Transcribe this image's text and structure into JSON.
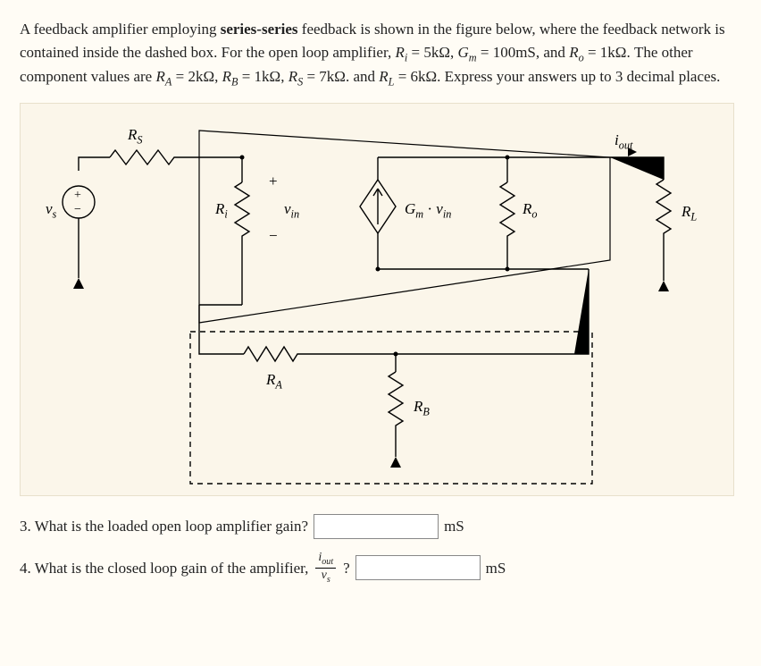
{
  "problem": {
    "intro_1": "A feedback amplifier employing ",
    "feedback_type": "series-series",
    "intro_2": " feedback is shown in the figure below, where the feedback network is contained inside the dashed box. For the open loop amplifier, ",
    "Ri_sym": "R",
    "Ri_sub": "i",
    "eq": " = ",
    "Ri_val": "5kΩ",
    "comma": ", ",
    "Gm_sym": "G",
    "Gm_sub": "m",
    "Gm_val": "100mS",
    "and1": ", and ",
    "Ro_sym": "R",
    "Ro_sub": "o",
    "Ro_val": "1kΩ",
    "period": ". ",
    "other_intro": "The other component values are ",
    "RA_sym": "R",
    "RA_sub": "A",
    "RA_val": "2kΩ",
    "RB_sym": "R",
    "RB_sub": "B",
    "RB_val": "1kΩ",
    "RS_sym": "R",
    "RS_sub": "S",
    "RS_val": "7kΩ",
    "and2": ". and ",
    "RL_sym": "R",
    "RL_sub": "L",
    "RL_val": "6kΩ",
    "closing": ". Express your answers up to 3 decimal places."
  },
  "circuit": {
    "RS": "R",
    "RS_sub": "S",
    "vs": "v",
    "vs_sub": "s",
    "Ri": "R",
    "Ri_sub": "i",
    "vin": "v",
    "vin_sub": "in",
    "plus": "+",
    "minus": "−",
    "Gm": "G",
    "Gm_sub": "m",
    "dot": " · ",
    "Ro": "R",
    "Ro_sub": "o",
    "iout": "i",
    "iout_sub": "out",
    "RL": "R",
    "RL_sub": "L",
    "RA": "R",
    "RA_sub": "A",
    "RB": "R",
    "RB_sub": "B"
  },
  "questions": {
    "q3_text": "3. What is the loaded open loop amplifier gain?",
    "q3_unit": "mS",
    "q4_text_a": "4. What is the closed loop gain of the amplifier, ",
    "q4_frac_num_sym": "i",
    "q4_frac_num_sub": "out",
    "q4_frac_den_sym": "v",
    "q4_frac_den_sub": "s",
    "q4_text_b": " ?",
    "q4_unit": "mS"
  }
}
